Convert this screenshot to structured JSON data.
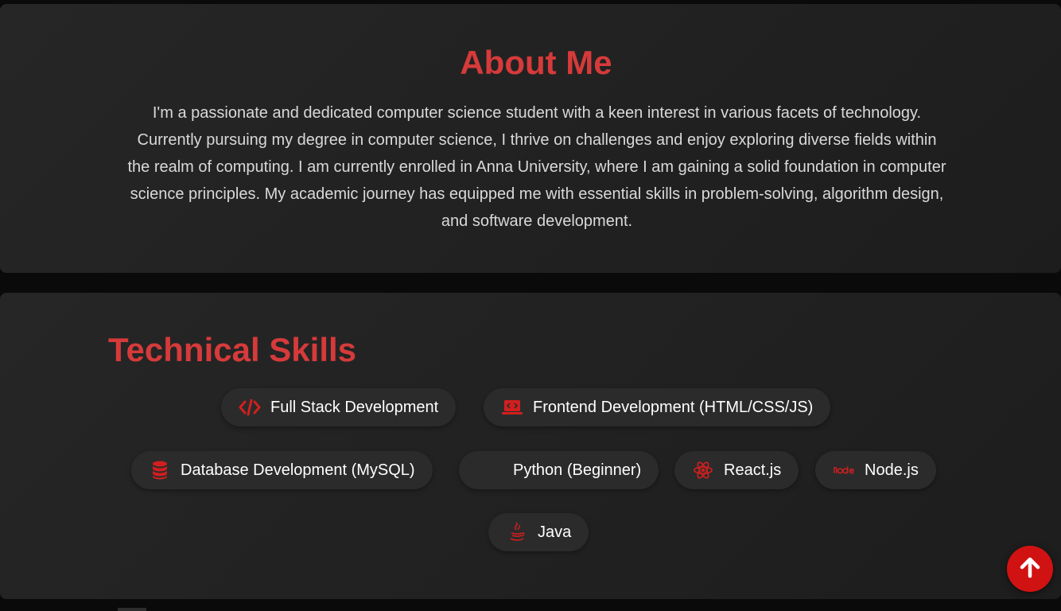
{
  "about": {
    "title": "About Me",
    "text": "I'm a passionate and dedicated computer science student with a keen interest in various facets of technology. Currently pursuing my degree in computer science, I thrive on challenges and enjoy exploring diverse fields within the realm of computing. I am currently enrolled in Anna University, where I am gaining a solid foundation in computer science principles. My academic journey has equipped me with essential skills in problem-solving, algorithm design, and software development."
  },
  "skills": {
    "title": "Technical Skills",
    "items": [
      {
        "label": "Full Stack Development",
        "icon": "code-icon"
      },
      {
        "label": "Frontend Development (HTML/CSS/JS)",
        "icon": "laptop-code-icon"
      },
      {
        "label": "Database Development (MySQL)",
        "icon": "database-icon"
      },
      {
        "label": "Python (Beginner)",
        "icon": "python-icon"
      },
      {
        "label": "React.js",
        "icon": "react-icon"
      },
      {
        "label": "Node.js",
        "icon": "node-icon"
      },
      {
        "label": "Java",
        "icon": "java-icon"
      }
    ]
  },
  "scroll_top": {
    "icon": "arrow-up-icon"
  },
  "colors": {
    "accent": "#d63a3a",
    "button": "#d11212",
    "background": "#0a0a0a",
    "card": "#232323"
  }
}
